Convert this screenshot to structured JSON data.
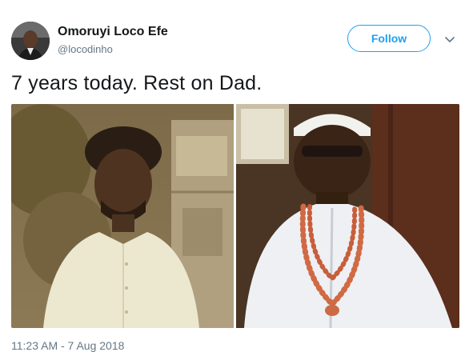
{
  "tweet": {
    "author": {
      "display_name": "Omoruyi Loco Efe",
      "handle": "@locodinho"
    },
    "follow_label": "Follow",
    "text": "7 years today. Rest on Dad.",
    "timestamp": "11:23 AM - 7 Aug 2018",
    "photo_count": 2
  },
  "icons": {
    "more_menu": "chevron-down-icon"
  },
  "colors": {
    "accent": "#1da1f2",
    "text_primary": "#14171a",
    "text_secondary": "#657786"
  }
}
